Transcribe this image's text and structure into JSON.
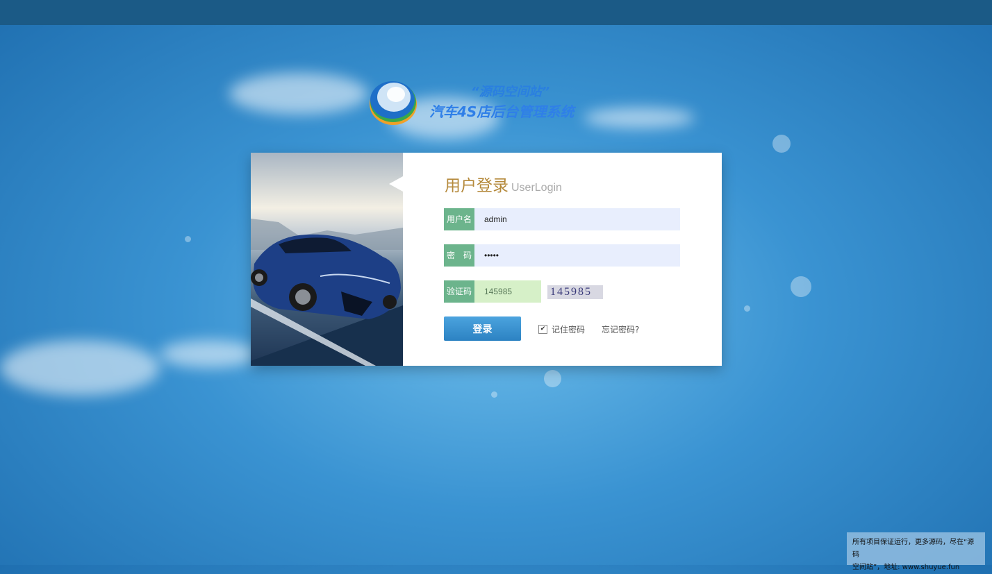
{
  "header": {
    "logo_line1": "“源码空间站”",
    "logo_line2": "汽车4S店后台管理系统"
  },
  "login": {
    "title_cn": "用户登录",
    "title_en": "UserLogin",
    "username_label": "用户名",
    "username_value": "admin",
    "password_label": "密　码",
    "password_value": "•••••",
    "captcha_label": "验证码",
    "captcha_value": "145985",
    "captcha_image_text": "145985",
    "login_button": "登录",
    "remember_label": "记住密码",
    "remember_checked": true,
    "forgot_link": "忘记密码?"
  },
  "footer": {
    "notice_line1": "所有项目保证运行，更多源码，尽在“源码",
    "notice_line2": "空间站”，地址: www.shuyue.fun"
  },
  "colors": {
    "accent_green": "#6cb48c",
    "button_blue": "#2c82c2",
    "title_gold": "#b58a3c"
  }
}
